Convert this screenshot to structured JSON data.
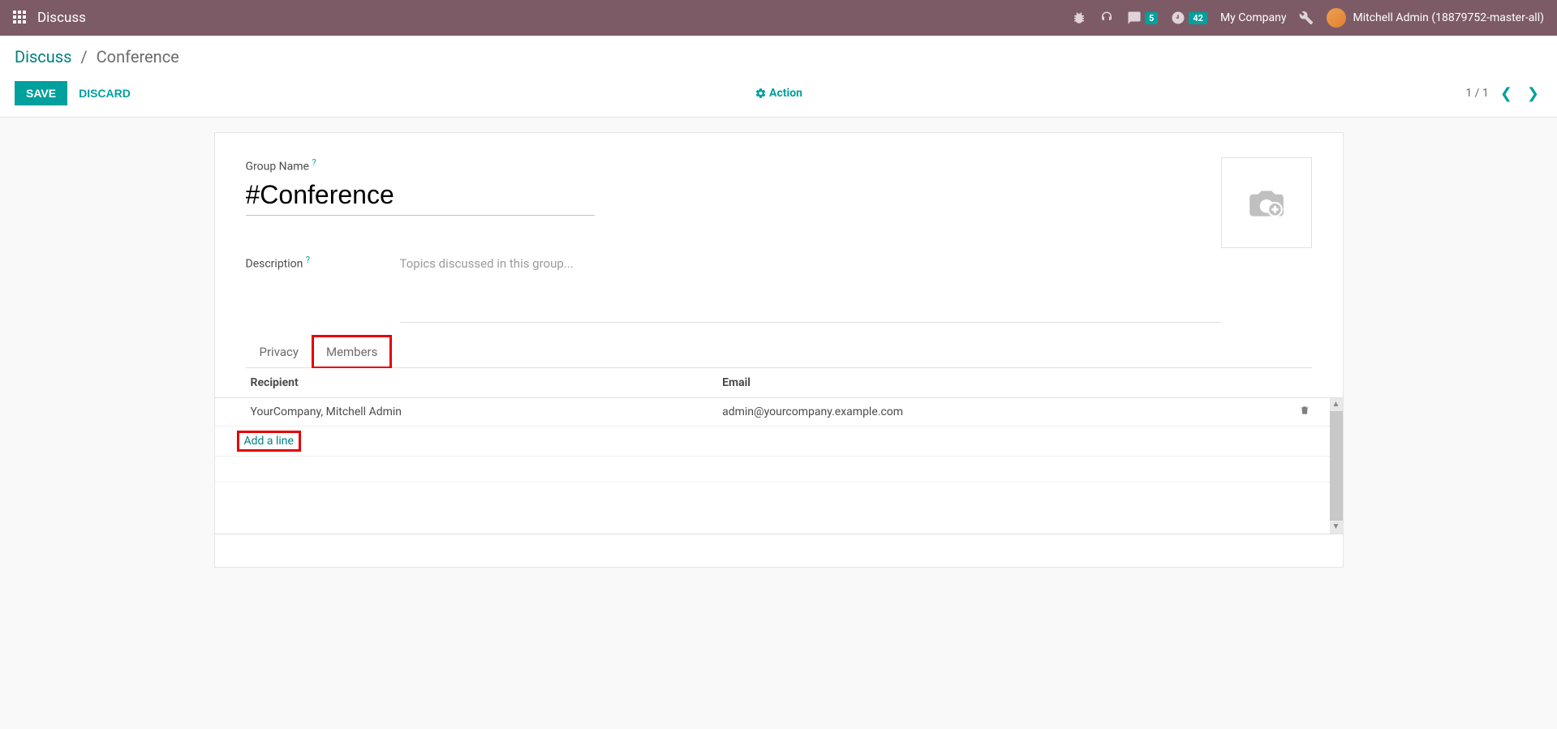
{
  "navbar": {
    "app_title": "Discuss",
    "messages_count": "5",
    "clock_count": "42",
    "company": "My Company",
    "user": "Mitchell Admin (18879752-master-all)"
  },
  "breadcrumb": {
    "root": "Discuss",
    "current": "Conference"
  },
  "toolbar": {
    "save": "SAVE",
    "discard": "DISCARD",
    "action": "Action",
    "pager": "1 / 1"
  },
  "form": {
    "group_name_label": "Group Name",
    "group_name_value": "#Conference",
    "description_label": "Description",
    "description_placeholder": "Topics discussed in this group..."
  },
  "tabs": {
    "privacy": "Privacy",
    "members": "Members"
  },
  "members": {
    "columns": {
      "recipient": "Recipient",
      "email": "Email"
    },
    "rows": [
      {
        "recipient": "YourCompany, Mitchell Admin",
        "email": "admin@yourcompany.example.com"
      }
    ],
    "add_line": "Add a line"
  }
}
